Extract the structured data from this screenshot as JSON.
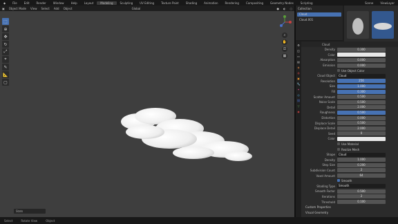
{
  "topbar": {
    "menus": [
      "File",
      "Edit",
      "Render",
      "Window",
      "Help",
      "Layout",
      "Modeling",
      "Sculpting",
      "UV Editing",
      "Texture Paint",
      "Shading",
      "Animation",
      "Rendering",
      "Compositing",
      "Geometry Nodes",
      "Scripting"
    ],
    "active_menu": "Modeling",
    "scene": "Scene",
    "view_layer": "ViewLayer"
  },
  "viewport_header": {
    "mode": "Object Mode",
    "menus": [
      "View",
      "Select",
      "Add",
      "Object"
    ],
    "orientation": "Global"
  },
  "statusbar": {
    "items": [
      "Select",
      "Rotate View",
      "Object"
    ],
    "stats_field": "Stats"
  },
  "outliner": {
    "header": "Collection",
    "items": [
      "Cloud",
      "Cloud.001"
    ],
    "selected_index": 0
  },
  "properties": {
    "header": "Cloud",
    "rows": [
      {
        "label": "Density",
        "value": "0.300",
        "style": "gray"
      },
      {
        "label": "Color",
        "value": "",
        "style": "white"
      },
      {
        "label": "Absorption",
        "value": "0.000",
        "style": "gray"
      },
      {
        "label": "Emission",
        "value": "0.000",
        "style": "gray"
      },
      {
        "label": "",
        "value": "Use Object Color",
        "style": "check"
      },
      {
        "label": "Cloud Object",
        "value": "Cloud",
        "style": "dark"
      },
      {
        "label": "Resolution",
        "value": "256",
        "style": "blue"
      },
      {
        "label": "Size",
        "value": "1.000",
        "style": "blue"
      },
      {
        "label": "Fill",
        "value": "0.300",
        "style": "blue"
      },
      {
        "label": "Scatter Amount",
        "value": "0.500",
        "style": "gray"
      },
      {
        "label": "Noise Scale",
        "value": "0.500",
        "style": "gray"
      },
      {
        "label": "Detail",
        "value": "2.000",
        "style": "gray"
      },
      {
        "label": "Roughness",
        "value": "0.500",
        "style": "blue"
      },
      {
        "label": "Distortion",
        "value": "0.000",
        "style": "gray"
      },
      {
        "label": "Displace Scale",
        "value": "0.500",
        "style": "gray"
      },
      {
        "label": "Displace Detail",
        "value": "2.000",
        "style": "gray"
      },
      {
        "label": "Seed",
        "value": "0",
        "style": "gray"
      },
      {
        "label": "Color",
        "value": "",
        "style": "white"
      },
      {
        "label": "",
        "value": "Use Material",
        "style": "check"
      },
      {
        "label": "",
        "value": "Realize Mesh",
        "style": "check"
      },
      {
        "label": "Shape",
        "value": "Cloud",
        "style": "dark"
      },
      {
        "label": "Density",
        "value": "1.000",
        "style": "gray"
      },
      {
        "label": "Step Size",
        "value": "0.200",
        "style": "gray"
      },
      {
        "label": "Subdivision Count",
        "value": "2",
        "style": "gray"
      },
      {
        "label": "Voxel Amount",
        "value": "64",
        "style": "gray"
      },
      {
        "label": "",
        "value": "Smooth",
        "style": "checkon"
      },
      {
        "label": "Shading Type",
        "value": "Smooth",
        "style": "dark"
      },
      {
        "label": "Smooth Factor",
        "value": "0.500",
        "style": "gray"
      },
      {
        "label": "Iterations",
        "value": "2",
        "style": "gray"
      },
      {
        "label": "Threshold",
        "value": "0.100",
        "style": "gray"
      }
    ],
    "sections": [
      "Custom Properties",
      "Visual Geometry"
    ]
  }
}
